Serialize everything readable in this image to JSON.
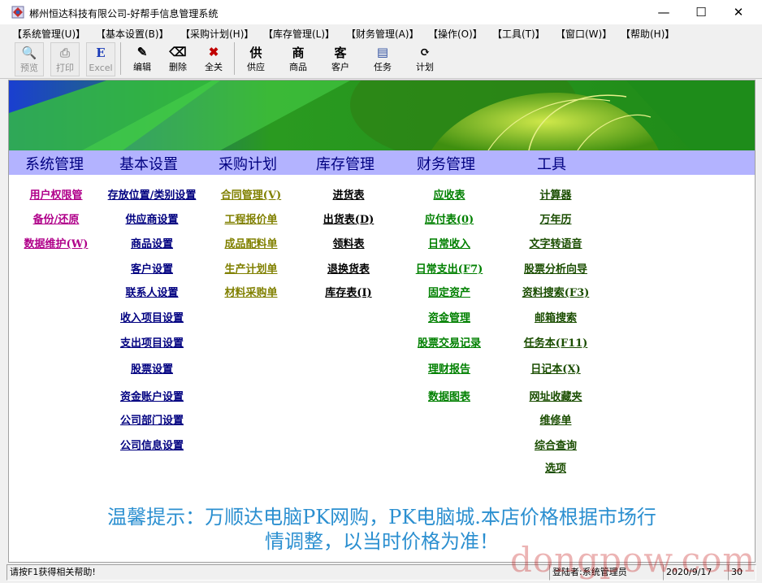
{
  "window": {
    "title": "郴州恒达科技有限公司-好帮手信息管理系统",
    "minimize_glyph": "—",
    "maximize_glyph": "☐",
    "close_glyph": "✕"
  },
  "menu": [
    "【系统管理(U)】",
    "【基本设置(B)】",
    "【采购计划(H)】",
    "【库存管理(L)】",
    "【财务管理(A)】",
    "【操作(O)】",
    "【工具(T)】",
    "【窗口(W)】",
    "【帮助(H)】"
  ],
  "toolbar": [
    {
      "label": "预览",
      "icon": "preview-icon",
      "glyph": "🔍",
      "enabled": false
    },
    {
      "label": "打印",
      "icon": "print-icon",
      "glyph": "⎙",
      "enabled": false
    },
    {
      "label": "Excel",
      "icon": "excel-icon",
      "glyph": "E",
      "enabled": false
    },
    {
      "label": "编辑",
      "icon": "edit-icon",
      "glyph": "✎",
      "enabled": true
    },
    {
      "label": "删除",
      "icon": "delete-icon",
      "glyph": "⌫",
      "enabled": true
    },
    {
      "label": "全关",
      "icon": "close-all-icon",
      "glyph": "✖",
      "enabled": true
    },
    {
      "label": "供应",
      "icon": "supply-icon",
      "glyph": "供",
      "enabled": true
    },
    {
      "label": "商品",
      "icon": "goods-icon",
      "glyph": "商",
      "enabled": true
    },
    {
      "label": "客户",
      "icon": "customer-icon",
      "glyph": "客",
      "enabled": true
    },
    {
      "label": "任务",
      "icon": "task-icon",
      "glyph": "▤",
      "enabled": true
    },
    {
      "label": "计划",
      "icon": "plan-icon",
      "glyph": "⟳",
      "enabled": true
    }
  ],
  "categories": [
    "系统管理",
    "基本设置",
    "采购计划",
    "库存管理",
    "财务管理",
    "工具"
  ],
  "columns": {
    "system": [
      "用户权限管",
      "备份/还原",
      "数据维护(W)"
    ],
    "basic": [
      "存放位置/类别设置",
      "供应商设置",
      "商品设置",
      "客户设置",
      "联系人设置",
      "收入项目设置",
      "支出项目设置",
      "股票设置",
      "资金账户设置",
      "公司部门设置",
      "公司信息设置"
    ],
    "purchase": [
      "合同管理(V)",
      "工程报价单",
      "成品配料单",
      "生产计划单",
      "材料采购单"
    ],
    "inventory": [
      "进货表",
      "出货表(D)",
      "领料表",
      "退换货表",
      "库存表(I)"
    ],
    "finance": [
      "应收表",
      "应付表(0)",
      "日常收入",
      "日常支出(F7)",
      "固定资产",
      "资金管理",
      "股票交易记录",
      "理财报告",
      "数据图表"
    ],
    "tools": [
      "计算器",
      "万年历",
      "文字转语音",
      "股票分析向导",
      "资料搜索(F3)",
      "邮箱搜索",
      "任务本(F11)",
      "日记本(X)",
      "网址收藏夹",
      "维修单",
      "综合查询",
      "选项"
    ]
  },
  "colors": {
    "system": "#b0008a",
    "basic": "#000080",
    "purchase": "#808000",
    "inventory": "#000000",
    "finance": "#008000",
    "tools": "#1a4d00",
    "category_bar": "#b3b3ff",
    "notice": "#2b8fd0"
  },
  "notice": {
    "line1": "温馨提示：万顺达电脑PK网购，PK电脑城.本店价格根据市场行",
    "line2": "情调整，以当时价格为准！"
  },
  "status": {
    "help": "请按F1获得相关帮助!",
    "user": "登陆者:系统管理员",
    "date": "2020/9/17",
    "extra": "30"
  },
  "watermark": "dongpow.com"
}
